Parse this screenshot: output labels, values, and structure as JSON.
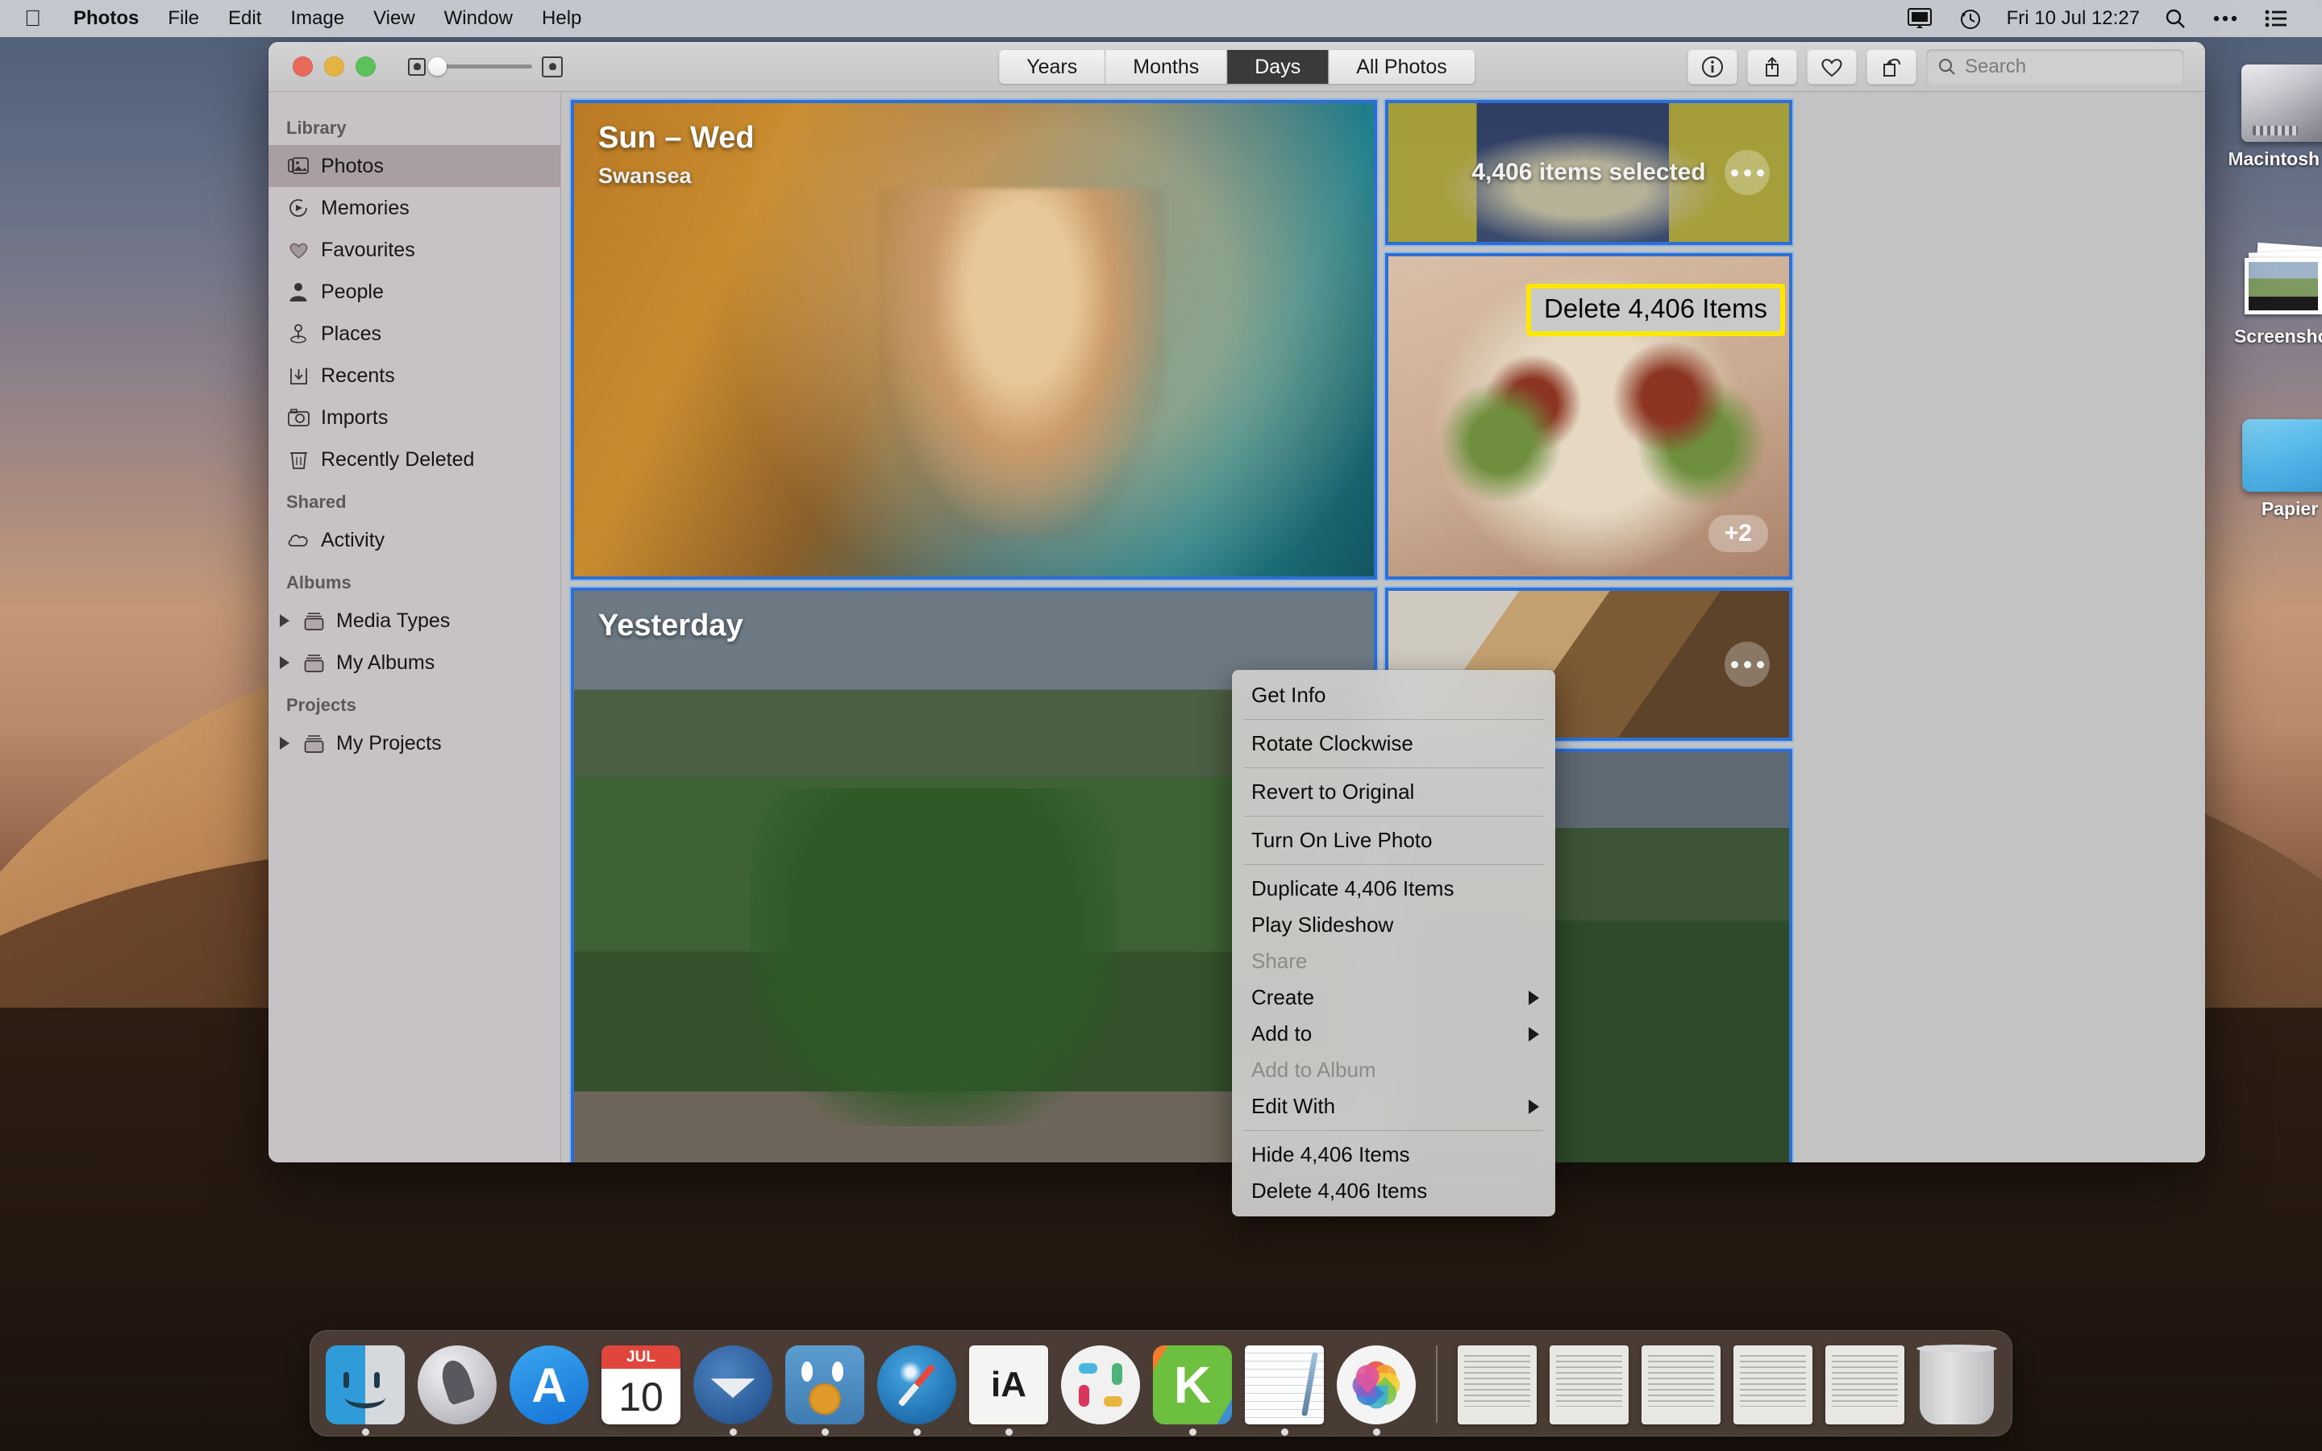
{
  "menubar": {
    "apple_icon": "apple-icon",
    "items": [
      {
        "label": "Photos",
        "bold": true
      },
      {
        "label": "File",
        "bold": false
      },
      {
        "label": "Edit",
        "bold": false
      },
      {
        "label": "Image",
        "bold": false
      },
      {
        "label": "View",
        "bold": false
      },
      {
        "label": "Window",
        "bold": false
      },
      {
        "label": "Help",
        "bold": false
      }
    ],
    "status": {
      "display_icon": "display-icon",
      "timemachine_icon": "time-machine-icon",
      "clock": "Fri 10 Jul  12:27",
      "search_icon": "spotlight-search-icon",
      "siri_icon": "control-centre-icon",
      "notifications_icon": "notification-centre-icon"
    }
  },
  "desktop": {
    "icons": [
      {
        "label": "Macintosh HD",
        "name": "macintosh-hd-icon"
      },
      {
        "label": "Screenshots",
        "name": "screenshots-folder-icon"
      },
      {
        "label": "Papier",
        "name": "papier-file-icon"
      }
    ]
  },
  "window": {
    "traffic": {
      "close": "close-button",
      "minimize": "minimize-button",
      "zoom": "zoom-button"
    },
    "zoom_slider": {
      "small_icon": "small-thumbnail-icon",
      "large_icon": "large-thumbnail-icon",
      "value": 8
    },
    "segments": [
      {
        "label": "Years",
        "active": false
      },
      {
        "label": "Months",
        "active": false
      },
      {
        "label": "Days",
        "active": true
      },
      {
        "label": "All Photos",
        "active": false
      }
    ],
    "toolbar_buttons": [
      {
        "name": "info-button",
        "icon": "info-icon"
      },
      {
        "name": "share-button",
        "icon": "share-icon"
      },
      {
        "name": "favourite-button",
        "icon": "heart-icon"
      },
      {
        "name": "rotate-button",
        "icon": "rotate-icon"
      }
    ],
    "search": {
      "placeholder": "Search",
      "value": "",
      "icon": "search-icon"
    }
  },
  "sidebar": {
    "sections": [
      {
        "title": "Library",
        "items": [
          {
            "label": "Photos",
            "icon": "photos-library-icon",
            "selected": true,
            "disclosure": false
          },
          {
            "label": "Memories",
            "icon": "memories-icon",
            "selected": false,
            "disclosure": false
          },
          {
            "label": "Favourites",
            "icon": "heart-icon",
            "selected": false,
            "disclosure": false
          },
          {
            "label": "People",
            "icon": "person-icon",
            "selected": false,
            "disclosure": false
          },
          {
            "label": "Places",
            "icon": "map-pin-icon",
            "selected": false,
            "disclosure": false
          },
          {
            "label": "Recents",
            "icon": "download-tray-icon",
            "selected": false,
            "disclosure": false
          },
          {
            "label": "Imports",
            "icon": "camera-icon",
            "selected": false,
            "disclosure": false
          },
          {
            "label": "Recently Deleted",
            "icon": "trash-icon",
            "selected": false,
            "disclosure": false
          }
        ]
      },
      {
        "title": "Shared",
        "items": [
          {
            "label": "Activity",
            "icon": "cloud-icon",
            "selected": false,
            "disclosure": false
          }
        ]
      },
      {
        "title": "Albums",
        "items": [
          {
            "label": "Media Types",
            "icon": "folder-icon",
            "selected": false,
            "disclosure": true
          },
          {
            "label": "My Albums",
            "icon": "folder-icon",
            "selected": false,
            "disclosure": true
          }
        ]
      },
      {
        "title": "Projects",
        "items": [
          {
            "label": "My Projects",
            "icon": "folder-icon",
            "selected": false,
            "disclosure": true
          }
        ]
      }
    ]
  },
  "grid": {
    "day_groups": [
      {
        "title": "Sun – Wed",
        "subtitle": "Swansea",
        "selection_label": "4,406 items selected"
      },
      {
        "title": "Yesterday",
        "subtitle": ""
      }
    ],
    "badges": {
      "plus_count": "+2",
      "more_icon": "ellipsis-icon"
    }
  },
  "context_menu": {
    "groups": [
      [
        {
          "label": "Get Info",
          "disabled": false,
          "submenu": false
        }
      ],
      [
        {
          "label": "Rotate Clockwise",
          "disabled": false,
          "submenu": false
        }
      ],
      [
        {
          "label": "Revert to Original",
          "disabled": false,
          "submenu": false
        }
      ],
      [
        {
          "label": "Turn On Live Photo",
          "disabled": false,
          "submenu": false
        }
      ],
      [
        {
          "label": "Duplicate 4,406 Items",
          "disabled": false,
          "submenu": false
        },
        {
          "label": "Play Slideshow",
          "disabled": false,
          "submenu": false
        },
        {
          "label": "Share",
          "disabled": true,
          "submenu": false
        },
        {
          "label": "Create",
          "disabled": false,
          "submenu": true
        },
        {
          "label": "Add to",
          "disabled": false,
          "submenu": true
        },
        {
          "label": "Add to Album",
          "disabled": true,
          "submenu": false
        },
        {
          "label": "Edit With",
          "disabled": false,
          "submenu": true
        }
      ],
      [
        {
          "label": "Hide 4,406 Items",
          "disabled": false,
          "submenu": false
        },
        {
          "label": "Delete 4,406 Items",
          "disabled": false,
          "submenu": false
        }
      ]
    ]
  },
  "annotation": {
    "callout_text": "Delete 4,406 Items",
    "highlight_colour": "#ffe800"
  },
  "dock": {
    "apps": [
      {
        "label": "Finder",
        "name": "finder-icon",
        "running": true
      },
      {
        "label": "Launchpad",
        "name": "launchpad-icon",
        "running": false
      },
      {
        "label": "App Store",
        "name": "app-store-icon",
        "running": false
      },
      {
        "label": "Calendar",
        "name": "calendar-icon",
        "running": false,
        "month": "JUL",
        "day": "10"
      },
      {
        "label": "Thunderbird",
        "name": "thunderbird-icon",
        "running": true
      },
      {
        "label": "Tweetbot",
        "name": "tweetbot-icon",
        "running": true
      },
      {
        "label": "Safari",
        "name": "safari-icon",
        "running": true
      },
      {
        "label": "iA Writer",
        "name": "ia-writer-icon",
        "running": true
      },
      {
        "label": "Slack",
        "name": "slack-icon",
        "running": false
      },
      {
        "label": "Kindle",
        "name": "kindle-icon",
        "running": true
      },
      {
        "label": "Notes",
        "name": "notes-icon",
        "running": true
      },
      {
        "label": "Photos",
        "name": "photos-icon",
        "running": true
      }
    ],
    "recents": [
      {
        "name": "document-notebook-icon"
      },
      {
        "name": "document-text-icon"
      },
      {
        "name": "document-list-icon"
      },
      {
        "name": "document-ia-icon"
      },
      {
        "name": "document-ia-2-icon"
      }
    ],
    "trash": {
      "name": "trash-icon"
    }
  }
}
